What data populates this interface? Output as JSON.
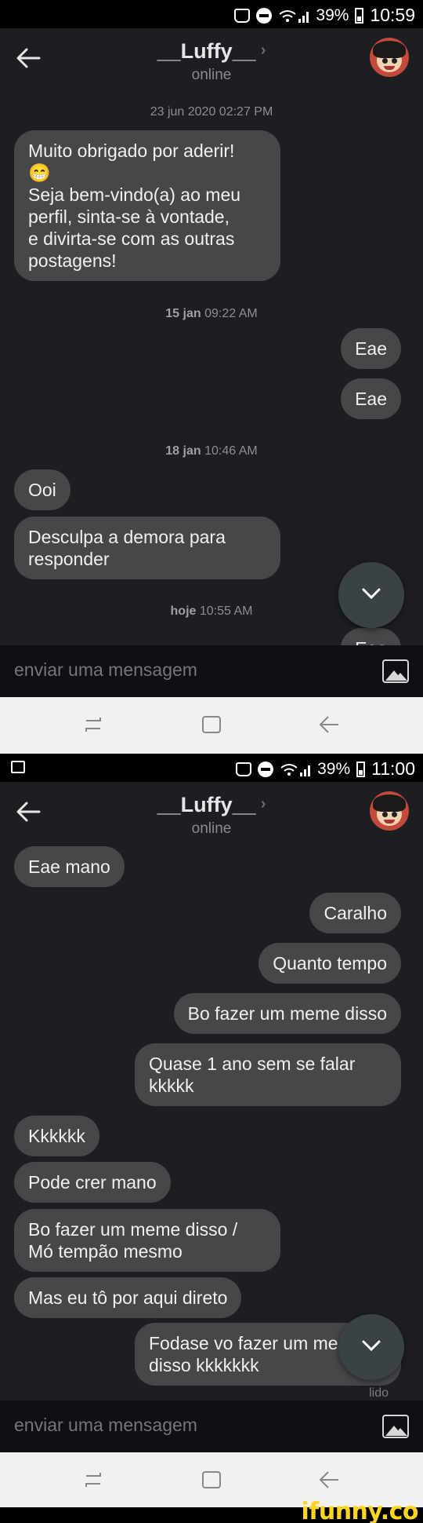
{
  "screen1": {
    "status": {
      "battery": "39%",
      "time": "10:59"
    },
    "header": {
      "title": "__Luffy__",
      "chevron": "›",
      "subtitle": "online"
    },
    "timestamps": [
      {
        "day": "23 jun 2020",
        "time": "02:27 PM"
      },
      {
        "day": "15 jan",
        "time": "09:22 AM"
      },
      {
        "day": "18 jan",
        "time": "10:46 AM"
      },
      {
        "day": "hoje",
        "time": "10:55 AM"
      }
    ],
    "messages": [
      {
        "side": "left",
        "text": "Muito obrigado por aderir!\n😁\nSeja bem-vindo(a) ao meu\nperfil, sinta-se à vontade,\ne divirta-se com as outras\npostagens!"
      },
      {
        "side": "right",
        "text": "Eae"
      },
      {
        "side": "right",
        "text": "Eae"
      },
      {
        "side": "left",
        "text": "Ooi"
      },
      {
        "side": "left",
        "text": "Desculpa a demora para\nresponder"
      },
      {
        "side": "right",
        "text": "Eae"
      }
    ],
    "composer": {
      "placeholder": "enviar uma mensagem"
    }
  },
  "screen2": {
    "status": {
      "battery": "39%",
      "time": "11:00"
    },
    "header": {
      "title": "__Luffy__",
      "chevron": "›",
      "subtitle": "online"
    },
    "messages": [
      {
        "side": "left",
        "text": "Eae mano"
      },
      {
        "side": "right",
        "text": "Caralho"
      },
      {
        "side": "right",
        "text": "Quanto tempo"
      },
      {
        "side": "right",
        "text": "Bo fazer um meme disso"
      },
      {
        "side": "right",
        "text": "Quase 1 ano sem se falar\nkkkkk"
      },
      {
        "side": "left",
        "text": "Kkkkkk"
      },
      {
        "side": "left",
        "text": "Pode crer mano"
      },
      {
        "side": "left",
        "text": "Bo fazer um meme disso /\nMó tempão mesmo"
      },
      {
        "side": "left",
        "text": "Mas eu tô por aqui direto"
      },
      {
        "side": "right",
        "text": "Fodase vo fazer um meme\ndisso kkkkkkk"
      }
    ],
    "read_label": "lido",
    "composer": {
      "placeholder": "enviar uma mensagem"
    }
  },
  "watermark": "ifunny.co",
  "colors": {
    "background": "#1d1e22",
    "bubble": "#464749",
    "accent": "#ffd51f"
  }
}
